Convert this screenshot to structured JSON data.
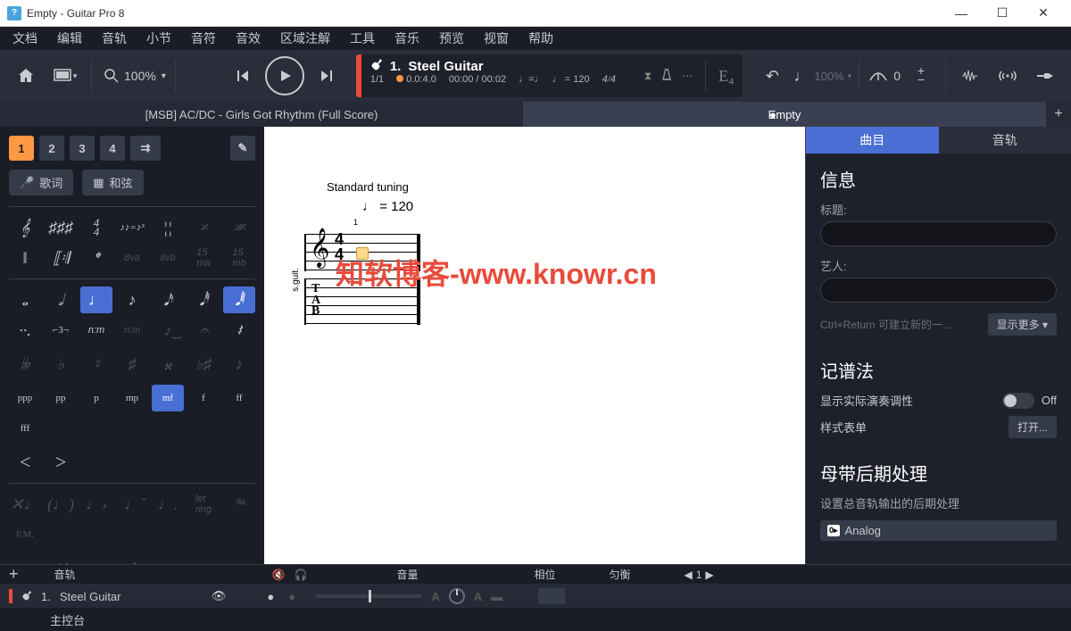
{
  "titlebar": {
    "doc": "Empty",
    "app": "Guitar Pro 8"
  },
  "menubar": [
    "文档",
    "编辑",
    "音轨",
    "小节",
    "音符",
    "音效",
    "区域注解",
    "工具",
    "音乐",
    "预览",
    "视窗",
    "帮助"
  ],
  "toolbar": {
    "zoom": "100%",
    "track_number": "1.",
    "track_name": "Steel Guitar",
    "bars": "1/1",
    "position": "0.0:4.0",
    "time_current": "00:00",
    "time_total": "00:02",
    "tempo_val": "120",
    "key": "E₄",
    "timesig_top": "4",
    "timesig_bot": "4",
    "speed_pct": "100%",
    "capo": "0"
  },
  "tabs": {
    "left": "[MSB] AC/DC - Girls Got Rhythm (Full Score)",
    "right": "Empty"
  },
  "left_panel": {
    "voices": [
      "1",
      "2",
      "3",
      "4"
    ],
    "lyrics": "歌词",
    "chords": "和弦",
    "dynamics": [
      "ppp",
      "pp",
      "p",
      "mp",
      "mf",
      "f",
      "ff",
      "fff"
    ]
  },
  "score": {
    "tuning": "Standard tuning",
    "tempo_label": "= 120",
    "instrument": "s.guit.",
    "timesig_top": "4",
    "timesig_bot": "4",
    "measure_num": "1"
  },
  "watermark": "知软博客-www.knowr.cn",
  "inspector": {
    "tab_song": "曲目",
    "tab_track": "音轨",
    "info_header": "信息",
    "title_label": "标题:",
    "artist_label": "艺人:",
    "hint": "Ctrl+Return 可建立新的一…",
    "show_more": "显示更多 ▾",
    "notation_header": "记谱法",
    "transpose_label": "显示实际演奏调性",
    "transpose_state": "Off",
    "stylesheet_label": "样式表单",
    "open_btn": "打开...",
    "master_header": "母带后期处理",
    "master_desc": "设置总音轨输出的后期处理",
    "preset": "Analog"
  },
  "bottom": {
    "plus": "+",
    "col_track": "音轨",
    "col_volume": "音量",
    "col_pan": "相位",
    "col_eq": "匀衡",
    "col_inst": "1",
    "track1_num": "1.",
    "track1_name": "Steel Guitar",
    "master": "主控台"
  }
}
